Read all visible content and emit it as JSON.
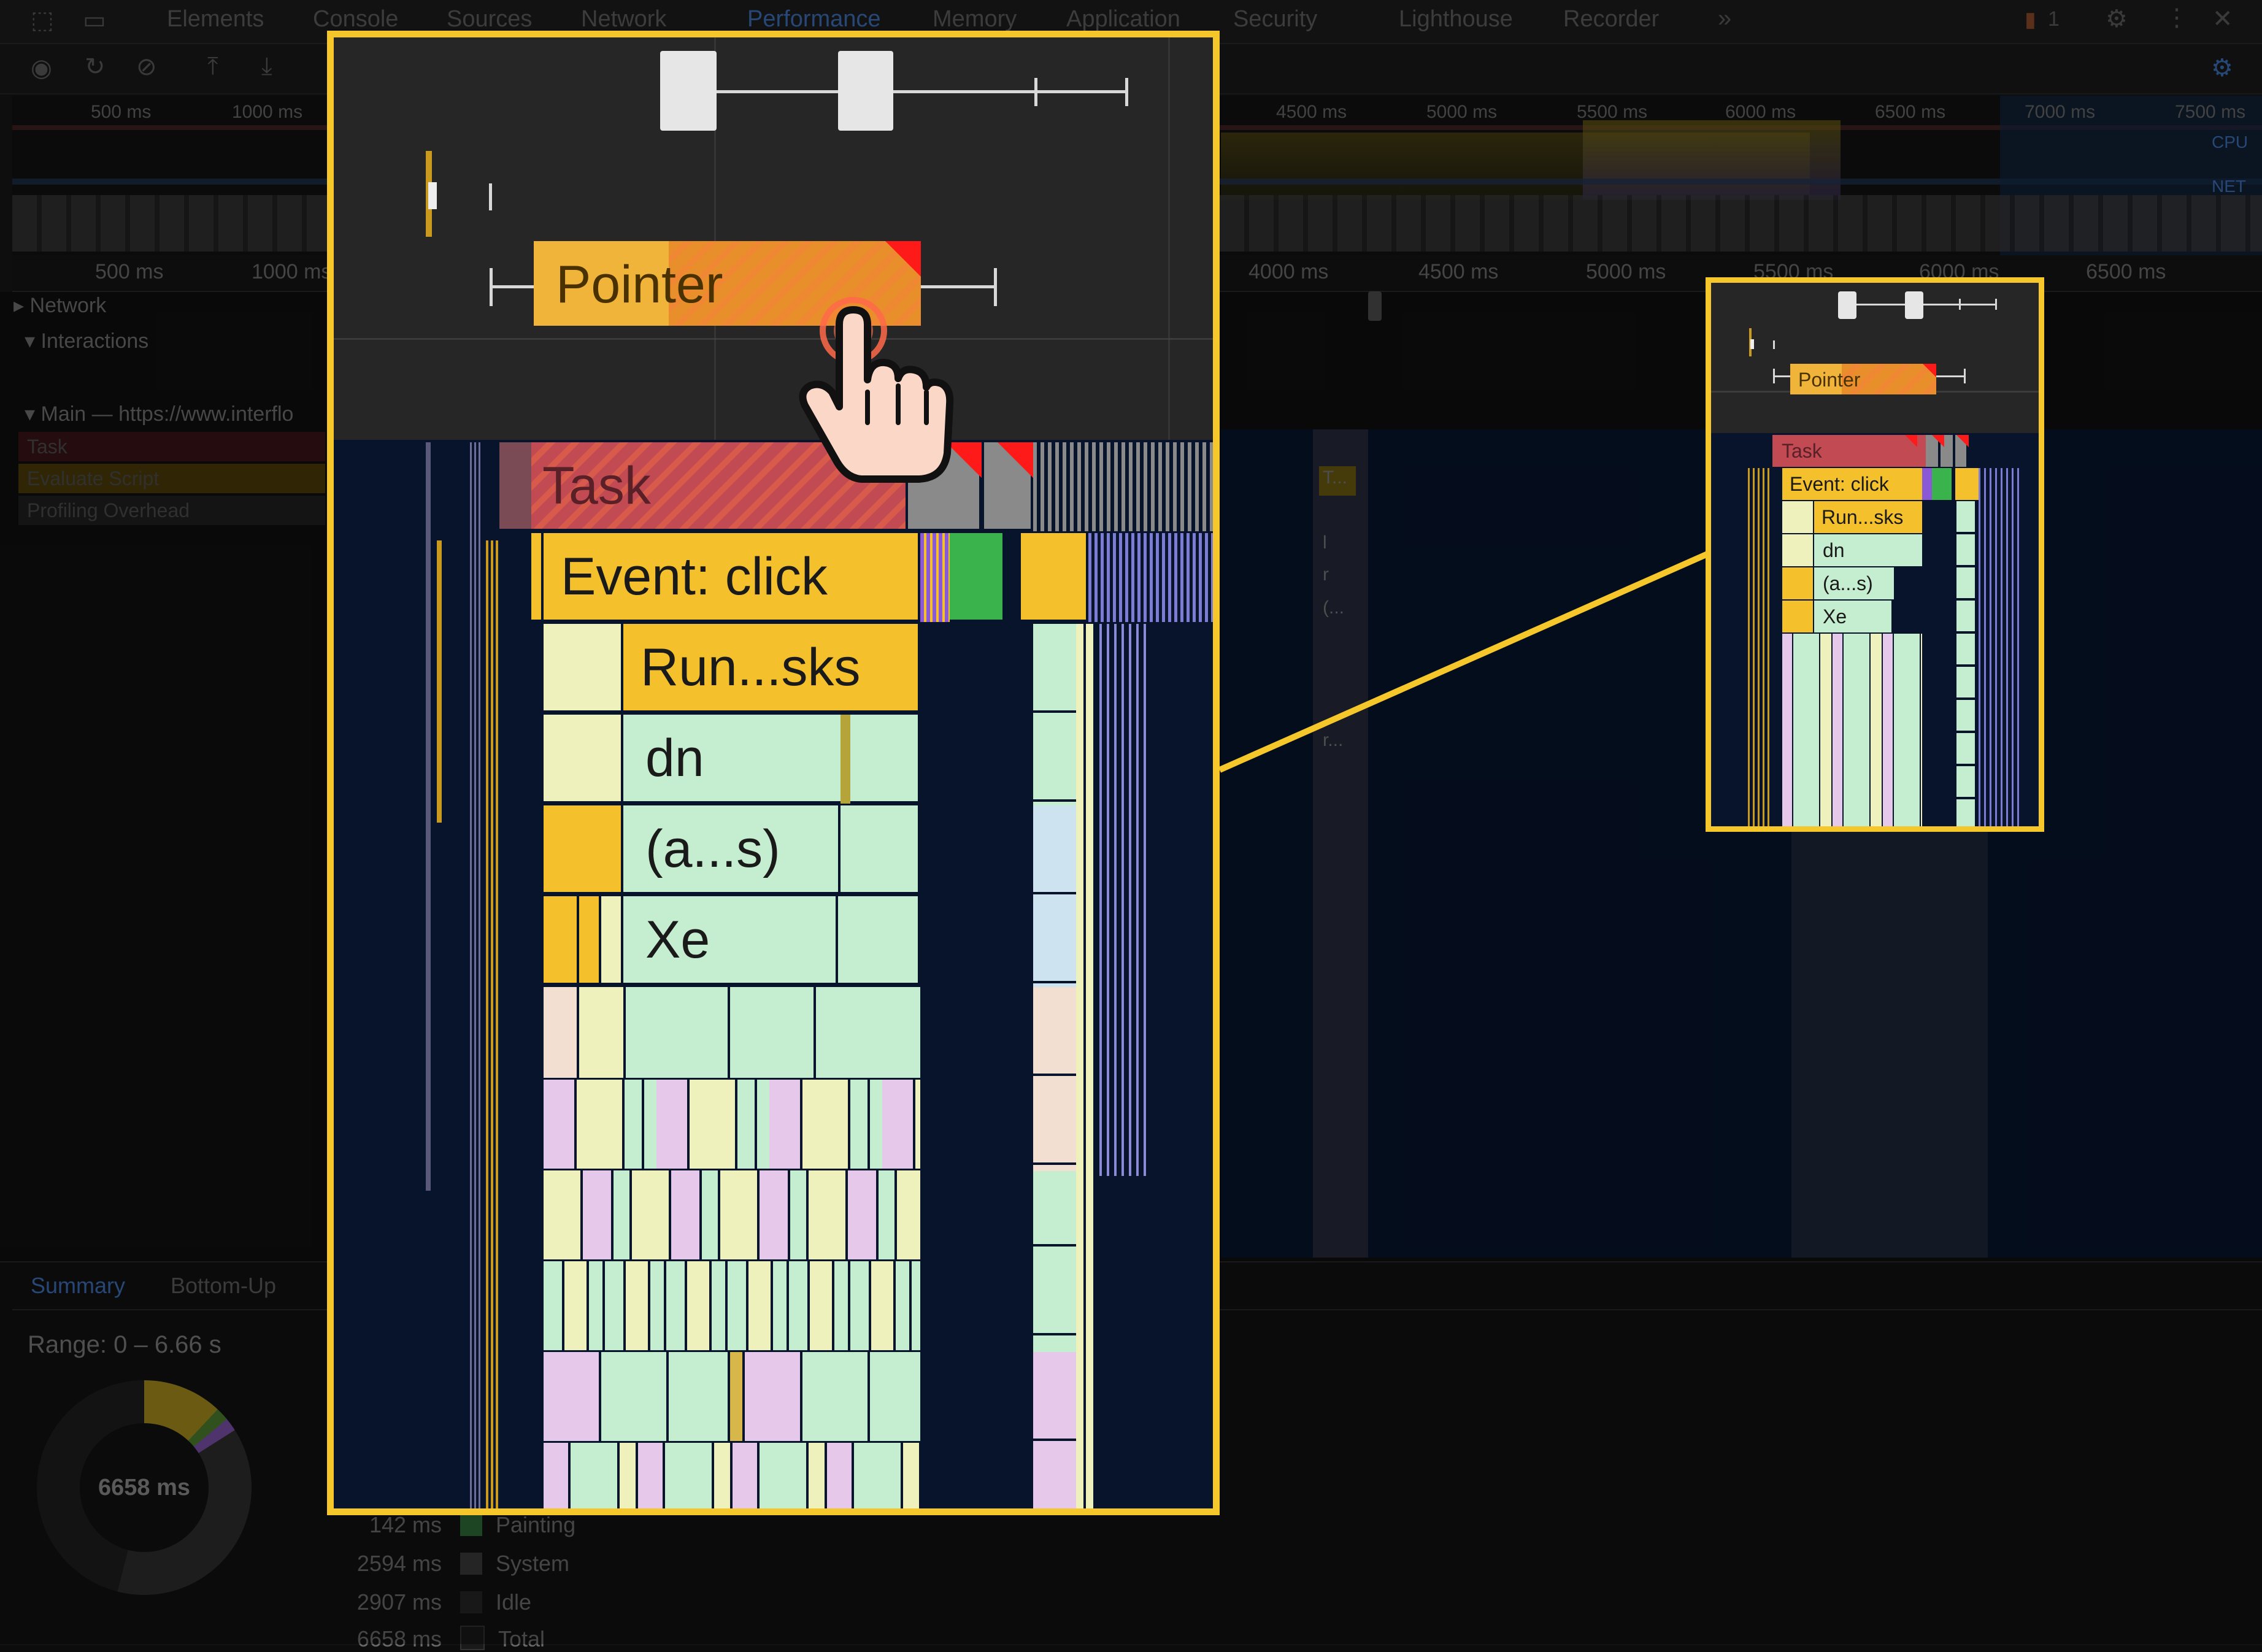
{
  "devtools": {
    "tabs": [
      "Elements",
      "Console",
      "Sources",
      "Network",
      "Performance",
      "Memory",
      "Application",
      "Security",
      "Lighthouse",
      "Recorder"
    ],
    "more_tabs_icon": "double-chevron-right-icon",
    "issues_count": "1",
    "overview_ticks": [
      "500 ms",
      "1000 ms",
      "4500 ms",
      "5000 ms",
      "5500 ms",
      "6000 ms",
      "6500 ms",
      "7000 ms",
      "7500 ms"
    ],
    "overview_side_labels": [
      "CPU",
      "NET"
    ],
    "ruler_ticks": [
      "500 ms",
      "1000 ms",
      "4000 ms",
      "4500 ms",
      "5000 ms",
      "5500 ms",
      "6000 ms",
      "6500 ms"
    ],
    "tracks": {
      "network": "Network",
      "interactions": "Interactions",
      "main": "Main — https://www.interflo"
    },
    "legend": [
      "Task",
      "Evaluate Script",
      "Profiling Overhead"
    ],
    "bg_flame_labels": [
      "T...",
      "l",
      "r",
      "(...",
      "r..."
    ],
    "bottom_tabs": [
      "Summary",
      "Bottom-Up"
    ],
    "range_text": "Range: 0 – 6.66 s",
    "donut_total": "6658 ms",
    "summary_rows": [
      {
        "ms": "142 ms",
        "label": "Painting",
        "color": "#2f6b36"
      },
      {
        "ms": "2594 ms",
        "label": "System",
        "color": "#3a3a3a"
      },
      {
        "ms": "2907 ms",
        "label": "Idle",
        "color": "#262626"
      },
      {
        "ms": "6658 ms",
        "label": "Total",
        "color": "#1a1a1a"
      }
    ]
  },
  "zoom": {
    "interaction_label": "Pointer",
    "task_label": "Task",
    "event_label": "Event: click",
    "run_label": "Run...sks",
    "fn1": "dn",
    "fn2": "(a...s)",
    "fn3": "Xe"
  },
  "colors": {
    "highlight": "#f6c72b",
    "task": "#c24a53",
    "event": "#f4c12d",
    "function": "#c5edcf",
    "background": "#07142b"
  }
}
